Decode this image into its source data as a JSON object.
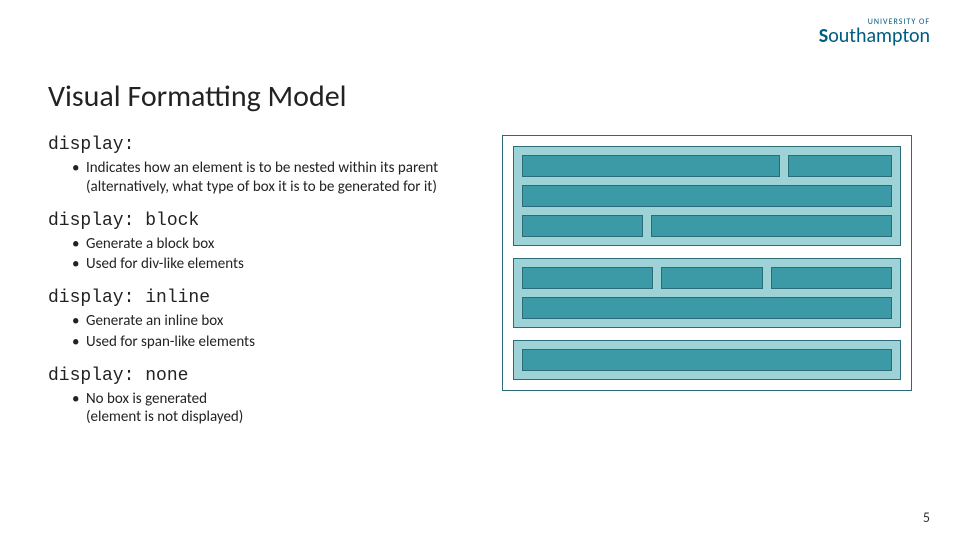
{
  "logo": {
    "top": "UNIVERSITY OF",
    "main_pre": "S",
    "main_post": "outhampton"
  },
  "title": "Visual Formatting Model",
  "sections": [
    {
      "heading": "display:",
      "bullets": [
        "Indicates how an element is to be nested within its parent (alternatively, what type of box it is to be generated for it)"
      ]
    },
    {
      "heading": "display: block",
      "bullets": [
        "Generate a block box",
        "Used for div-like elements"
      ]
    },
    {
      "heading": "display: inline",
      "bullets": [
        "Generate an inline box",
        "Used for span-like elements"
      ]
    },
    {
      "heading": "display: none",
      "bullets": [
        "No box is generated\n(element is not displayed)"
      ]
    }
  ],
  "page_number": "5"
}
